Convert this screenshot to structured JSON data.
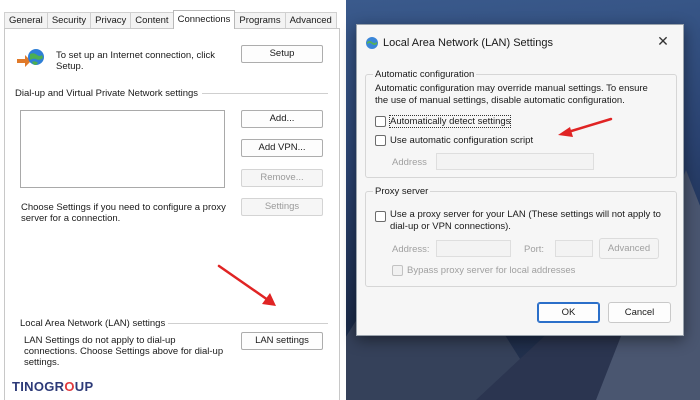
{
  "internet_options": {
    "tabs": [
      {
        "label": "General"
      },
      {
        "label": "Security"
      },
      {
        "label": "Privacy"
      },
      {
        "label": "Content"
      },
      {
        "label": "Connections",
        "active": true
      },
      {
        "label": "Programs"
      },
      {
        "label": "Advanced"
      }
    ],
    "setup_text_line1": "To set up an Internet connection, click",
    "setup_text_line2": "Setup.",
    "setup_button": "Setup",
    "dialup_group_label": "Dial-up and Virtual Private Network settings",
    "add_button": "Add...",
    "add_vpn_button": "Add VPN...",
    "remove_button": "Remove...",
    "choose_settings_line1": "Choose Settings if you need to configure a proxy",
    "choose_settings_line2": "server for a connection.",
    "settings_button": "Settings",
    "lan_group_label": "Local Area Network (LAN) settings",
    "lan_text_line1": "LAN Settings do not apply to dial-up",
    "lan_text_line2": "connections. Choose Settings above for dial-up",
    "lan_text_line3": "settings.",
    "lan_settings_button": "LAN settings"
  },
  "branding": {
    "logo_text_1": "TINOGR",
    "logo_text_accent": "O",
    "logo_text_2": "UP"
  },
  "lan_dialog": {
    "title": "Local Area Network (LAN) Settings",
    "close_glyph": "✕",
    "auto_config": {
      "group_label": "Automatic configuration",
      "description_line1": "Automatic configuration may override manual settings.  To ensure",
      "description_line2": "the use of manual settings, disable automatic configuration.",
      "auto_detect_label": "Automatically detect settings",
      "auto_detect_checked": false,
      "use_script_label": "Use automatic configuration script",
      "use_script_checked": false,
      "address_label": "Address"
    },
    "proxy": {
      "group_label": "Proxy server",
      "use_proxy_line1": "Use a proxy server for your LAN (These settings will not apply to",
      "use_proxy_line2": "dial-up or VPN connections).",
      "use_proxy_checked": false,
      "address_label": "Address:",
      "port_label": "Port:",
      "advanced_button": "Advanced",
      "bypass_label": "Bypass proxy server for local addresses",
      "bypass_checked": false
    },
    "ok_button": "OK",
    "cancel_button": "Cancel"
  },
  "colors": {
    "arrow": "#e02424",
    "primary_button_border": "#2b6fc9",
    "brand_text": "#2d3a78",
    "brand_accent": "#e03a3e"
  }
}
